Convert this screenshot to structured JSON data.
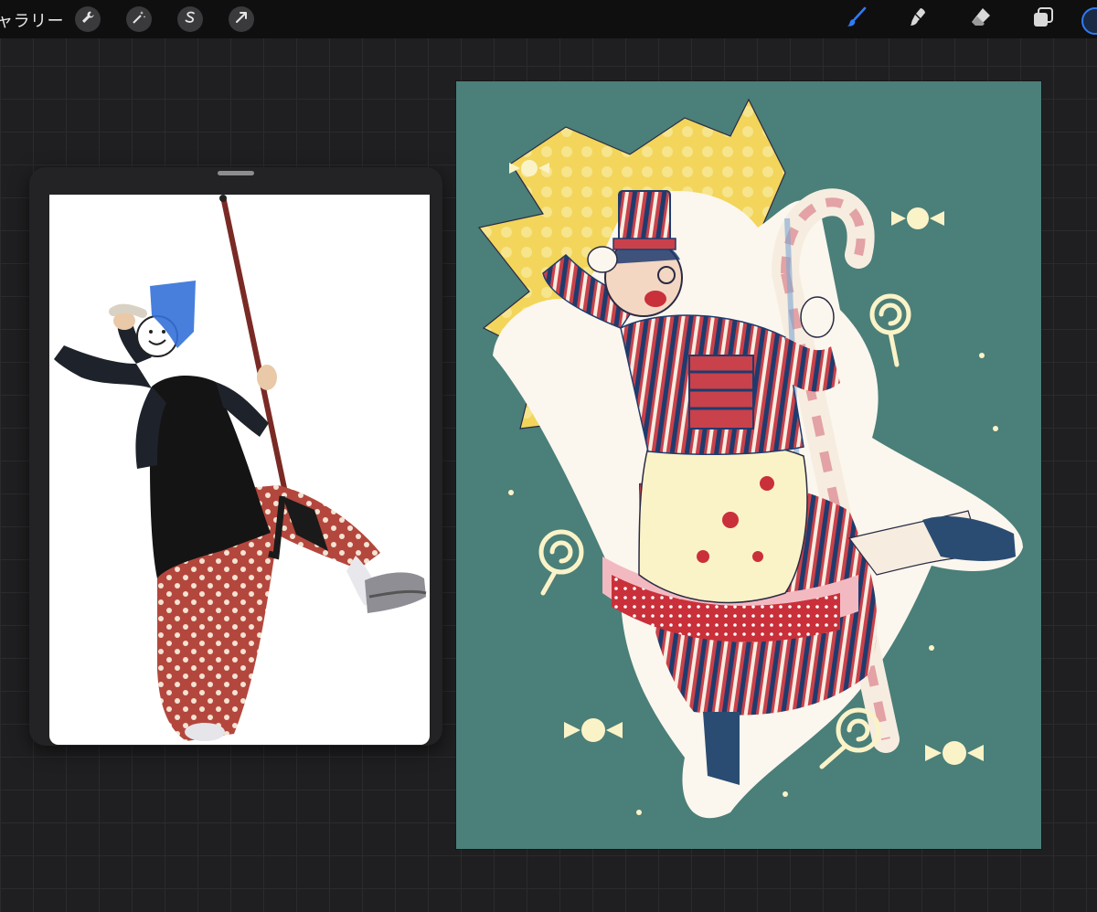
{
  "toolbar": {
    "gallery_label": "ャラリー",
    "left_tools": [
      {
        "name": "actions",
        "icon": "wrench-icon"
      },
      {
        "name": "adjustments",
        "icon": "magic-wand-icon"
      },
      {
        "name": "selection",
        "icon": "selection-s-icon"
      },
      {
        "name": "transform",
        "icon": "arrow-cursor-icon"
      }
    ],
    "right_tools": [
      {
        "name": "brush",
        "icon": "brush-icon",
        "active": true
      },
      {
        "name": "smudge",
        "icon": "smudge-icon"
      },
      {
        "name": "eraser",
        "icon": "eraser-icon"
      },
      {
        "name": "layers",
        "icon": "layers-icon"
      }
    ],
    "active_color": "#2f7bf6"
  },
  "reference": {
    "title": "",
    "image": "photo-reference-figure-with-broom"
  },
  "canvas": {
    "background_color": "#4b7f79",
    "artwork": "candy-soldier-maid-character-sketch",
    "accent_colors": [
      "#f2d55a",
      "#c9303a",
      "#1f3b6e",
      "#fbf3c8"
    ]
  }
}
